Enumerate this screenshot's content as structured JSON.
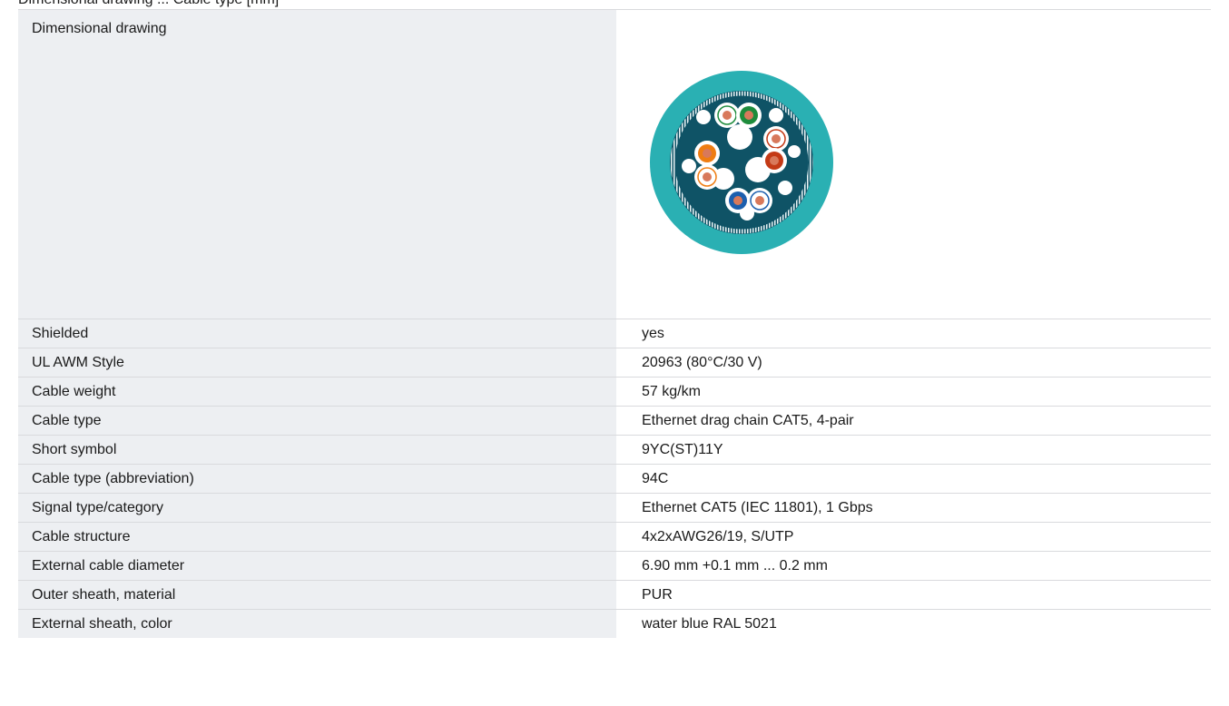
{
  "header": {
    "partial_text": "Dimensional drawing ... Cable type [mm]"
  },
  "drawing": {
    "label": "Dimensional drawing",
    "figure": "cable-cross-section",
    "colors": {
      "sheath": "#2ab0b3",
      "core": "#0f5366",
      "filler": "#ffffff",
      "pair_green": "#1e8c3c",
      "pair_red": "#c43a16",
      "pair_orange": "#ef7d12",
      "pair_blue": "#1c5fae",
      "copper": "#d8795b"
    }
  },
  "rows": [
    {
      "label": "Shielded",
      "value": "yes"
    },
    {
      "label": "UL AWM Style",
      "value": "20963 (80°C/30 V)"
    },
    {
      "label": "Cable weight",
      "value": "57 kg/km"
    },
    {
      "label": "Cable type",
      "value": "Ethernet drag chain CAT5, 4-pair"
    },
    {
      "label": "Short symbol",
      "value": "9YC(ST)11Y"
    },
    {
      "label": "Cable type (abbreviation)",
      "value": "94C"
    },
    {
      "label": "Signal type/category",
      "value": "Ethernet CAT5 (IEC 11801), 1 Gbps"
    },
    {
      "label": "Cable structure",
      "value": "4x2xAWG26/19, S/UTP"
    },
    {
      "label": "External cable diameter",
      "value": "6.90 mm +0.1 mm ... 0.2 mm"
    },
    {
      "label": "Outer sheath, material",
      "value": "PUR"
    },
    {
      "label": "External sheath, color",
      "value": "water blue RAL 5021"
    }
  ]
}
